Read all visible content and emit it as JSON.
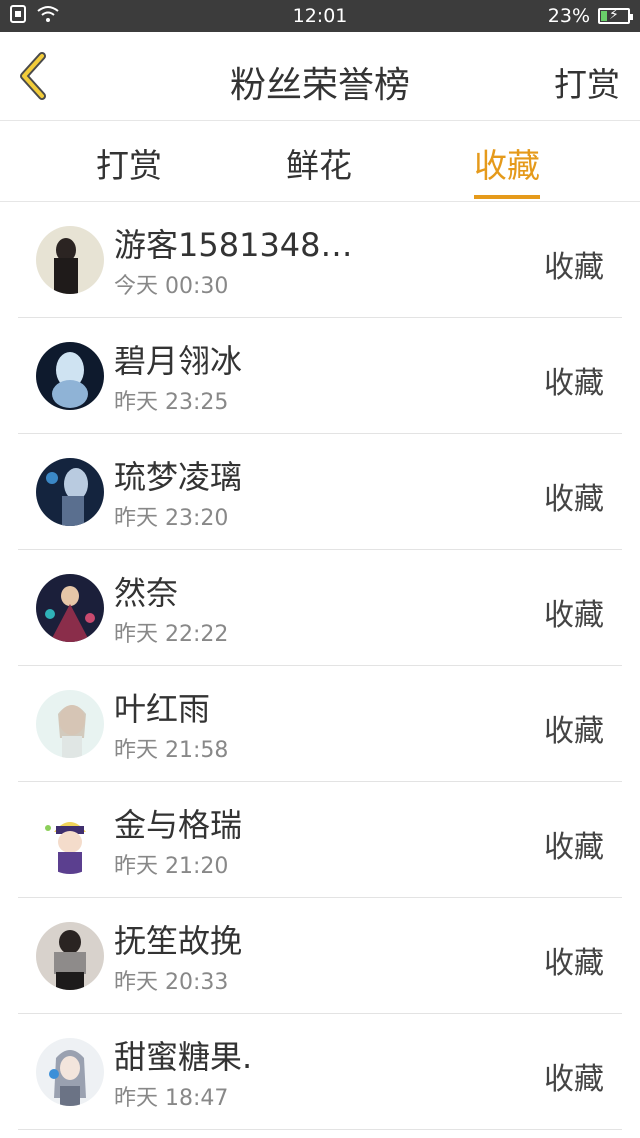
{
  "status_bar": {
    "time": "12:01",
    "battery": "23%",
    "battery_level": 0.23,
    "icons": [
      "sim-icon",
      "wifi-icon",
      "battery-charging-icon"
    ]
  },
  "header": {
    "back_icon": "chevron-left-icon",
    "title": "粉丝荣誉榜",
    "action": "打赏"
  },
  "tabs": [
    {
      "label": "打赏",
      "active": false
    },
    {
      "label": "鲜花",
      "active": false
    },
    {
      "label": "收藏",
      "active": true
    }
  ],
  "colors": {
    "accent": "#e59a1b",
    "status_bar_bg": "#3c3c3c",
    "text": "#333333",
    "muted": "#888888"
  },
  "fans": [
    {
      "name": "游客1581348…",
      "time": "今天  00:30",
      "action": "收藏"
    },
    {
      "name": "碧月翎冰",
      "time": "昨天  23:25",
      "action": "收藏"
    },
    {
      "name": "琉梦凌璃",
      "time": "昨天  23:20",
      "action": "收藏"
    },
    {
      "name": "然奈",
      "time": "昨天  22:22",
      "action": "收藏"
    },
    {
      "name": "叶红雨",
      "time": "昨天  21:58",
      "action": "收藏"
    },
    {
      "name": "金与格瑞",
      "time": "昨天  21:20",
      "action": "收藏"
    },
    {
      "name": "抚笙故挽",
      "time": "昨天  20:33",
      "action": "收藏"
    },
    {
      "name": "甜蜜糖果.",
      "time": "昨天  18:47",
      "action": "收藏"
    }
  ]
}
